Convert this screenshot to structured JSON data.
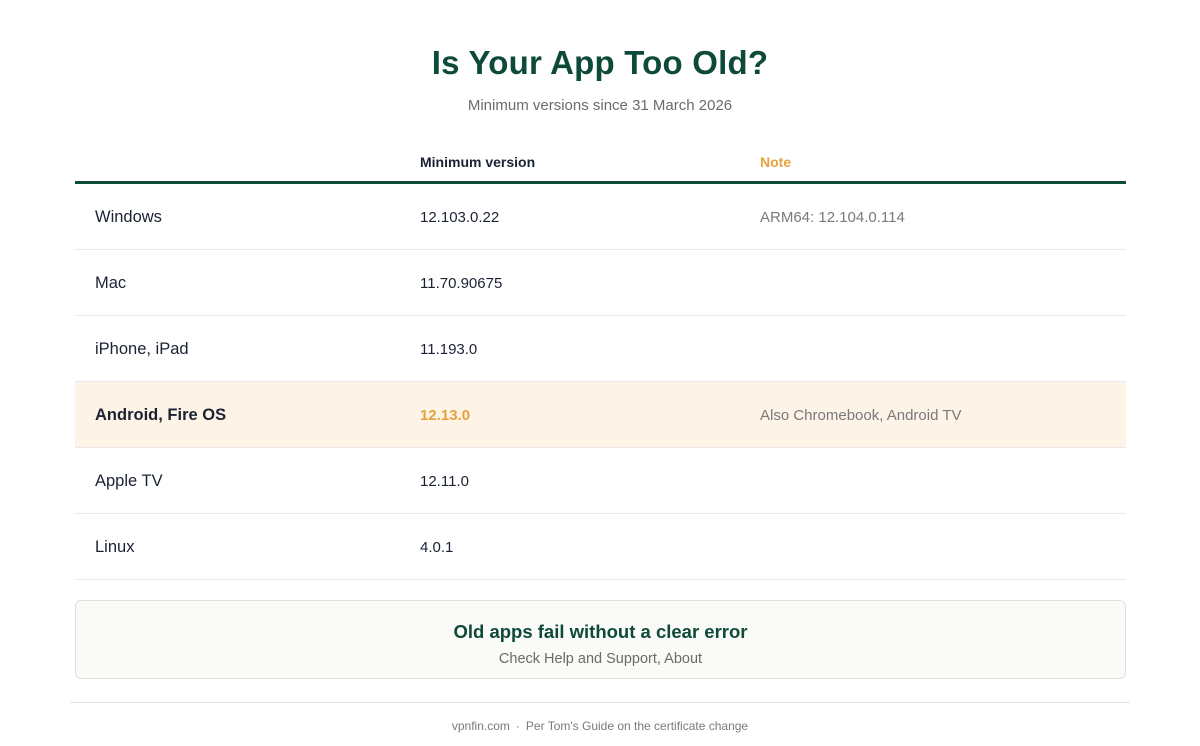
{
  "header": {
    "title": "Is Your App Too Old?",
    "subtitle": "Minimum versions since 31 March 2026"
  },
  "table": {
    "columns": {
      "platform": "",
      "version": "Minimum version",
      "note": "Note"
    },
    "rows": [
      {
        "platform": "Windows",
        "version": "12.103.0.22",
        "note": "ARM64: 12.104.0.114",
        "highlight": false
      },
      {
        "platform": "Mac",
        "version": "11.70.90675",
        "note": "",
        "highlight": false
      },
      {
        "platform": "iPhone, iPad",
        "version": "11.193.0",
        "note": "",
        "highlight": false
      },
      {
        "platform": "Android, Fire OS",
        "version": "12.13.0",
        "note": "Also Chromebook, Android TV",
        "highlight": true
      },
      {
        "platform": "Apple TV",
        "version": "12.11.0",
        "note": "",
        "highlight": false
      },
      {
        "platform": "Linux",
        "version": "4.0.1",
        "note": "",
        "highlight": false
      }
    ]
  },
  "callout": {
    "title": "Old apps fail without a clear error",
    "subtitle": "Check Help and Support, About"
  },
  "footer": {
    "source": "vpnfin.com",
    "separator": "·",
    "note": "Per Tom's Guide on the certificate change"
  },
  "colors": {
    "primary": "#0d4a3a",
    "accent": "#e6a23c",
    "highlight_bg": "#fdf3e6"
  }
}
